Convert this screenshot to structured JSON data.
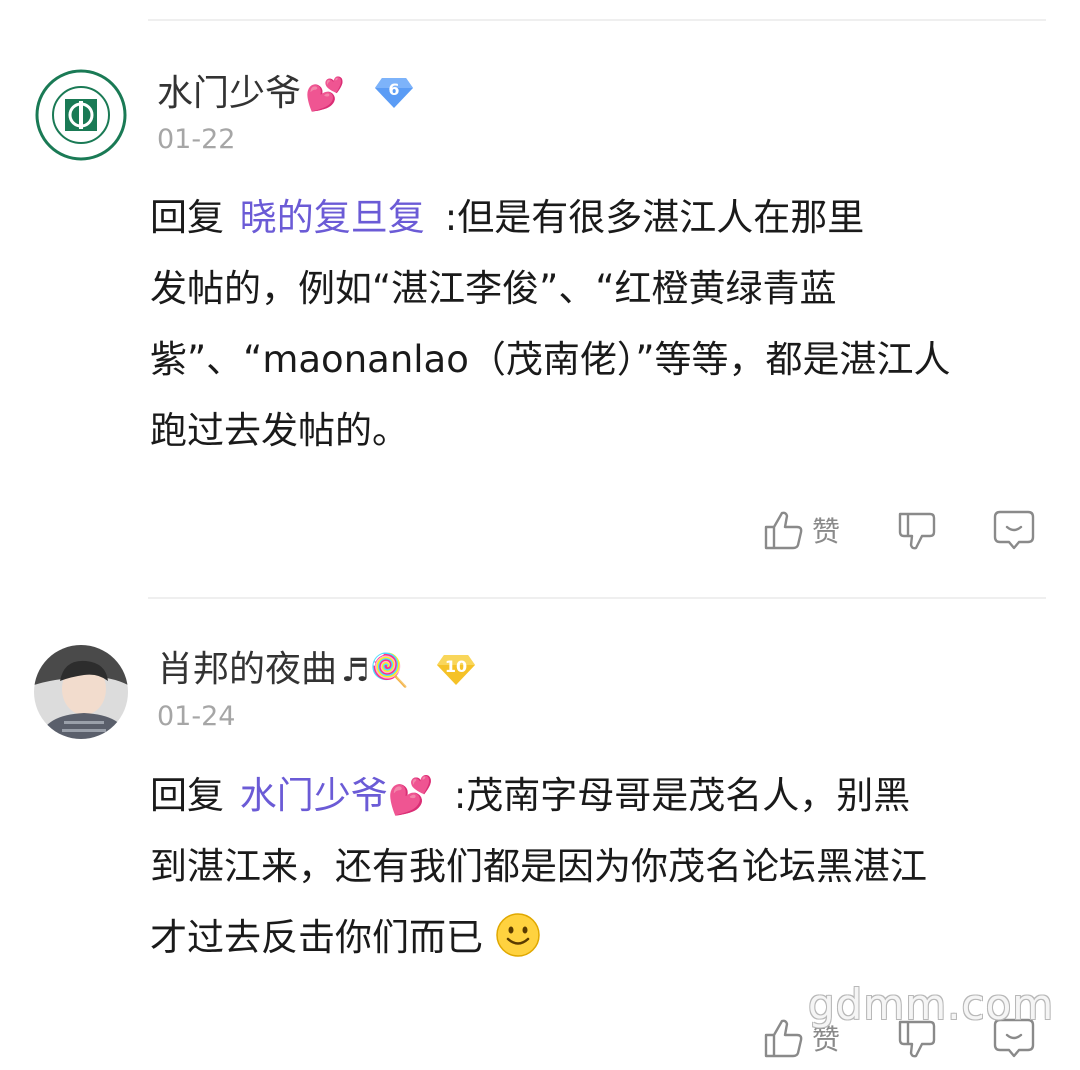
{
  "comments": [
    {
      "user": {
        "name": "水门少爷",
        "emoji": "💕",
        "level": "6",
        "avatar": "university-logo"
      },
      "date": "01-22",
      "reply_prefix": "回复",
      "reply_to": "晓的复旦复",
      "lines": [
        ":但是有很多湛江人在那里",
        "发帖的，例如“湛江李俊”、“红橙黄绿青蓝",
        "紫”、“maonanlao（茂南佬）”等等，都是湛江人",
        "跑过去发帖的。"
      ],
      "actions": {
        "like_label": "赞"
      }
    },
    {
      "user": {
        "name": "肖邦的夜曲",
        "emoji": "♬🍭",
        "level": "10",
        "avatar": "child-photo"
      },
      "date": "01-24",
      "reply_prefix": "回复",
      "reply_to": "水门少爷💕",
      "lines": [
        ":茂南字母哥是茂名人，别黑",
        "到湛江来，还有我们都是因为你茂名论坛黑湛江",
        "才过去反击你们而已"
      ],
      "actions": {
        "like_label": "赞"
      }
    }
  ],
  "watermark": "gdmm.com",
  "colors": {
    "reply_link": "#6b5bd6",
    "level_badge_1": "#5b9cf5",
    "level_badge_2": "#f5c228"
  }
}
